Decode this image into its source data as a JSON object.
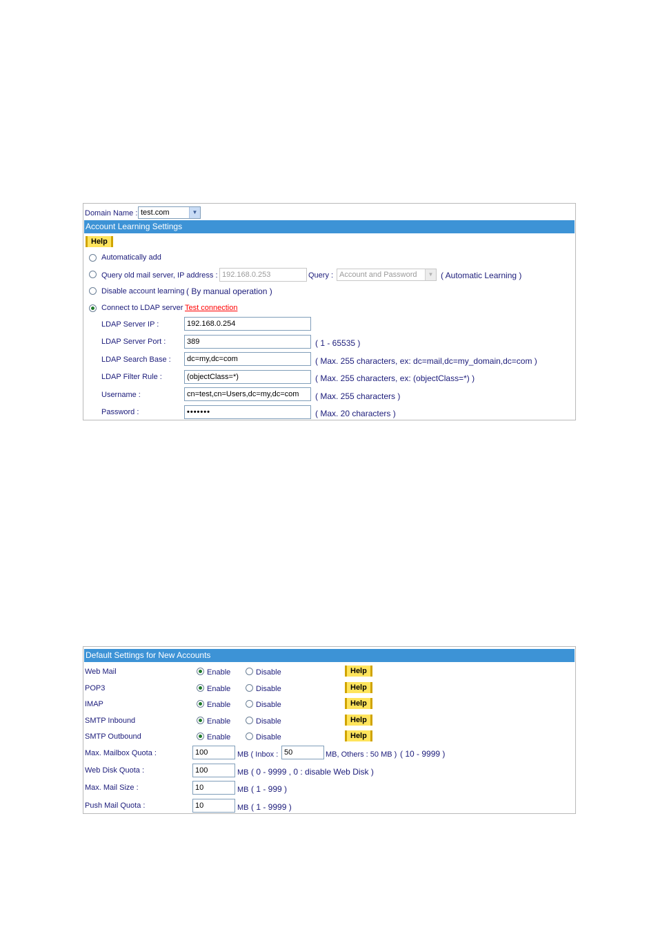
{
  "account_learning": {
    "domain_label": "Domain Name :",
    "domain_value": "test.com",
    "section_title": "Account Learning Settings",
    "help_label": "Help",
    "auto_add_label": "Automatically add",
    "query_old_label": "Query old mail server, IP address :",
    "query_ip_value": "192.168.0.253",
    "query_label": "Query :",
    "query_select_value": "Account and Password",
    "query_note": "( Automatic Learning )",
    "disable_label": "Disable account learning",
    "disable_note": "( By manual operation )",
    "ldap_label": "Connect to LDAP server",
    "test_connection_label": "Test connection",
    "fields": [
      {
        "label": "LDAP Server IP :",
        "value": "192.168.0.254",
        "note": ""
      },
      {
        "label": "LDAP Server Port :",
        "value": "389",
        "note": "( 1 - 65535 )"
      },
      {
        "label": "LDAP Search Base :",
        "value": "dc=my,dc=com",
        "note": "( Max. 255 characters, ex: dc=mail,dc=my_domain,dc=com )"
      },
      {
        "label": "LDAP Filter Rule :",
        "value": "(objectClass=*)",
        "note": "( Max. 255 characters, ex: (objectClass=*) )"
      },
      {
        "label": "Username :",
        "value": "cn=test,cn=Users,dc=my,dc=com",
        "note": "( Max. 255 characters )"
      },
      {
        "label": "Password :",
        "value": "•••••••",
        "note": "( Max. 20 characters )"
      }
    ],
    "selected_option": "ldap"
  },
  "defaults": {
    "section_title": "Default Settings for New Accounts",
    "enable_label": "Enable",
    "disable_label": "Disable",
    "help_label": "Help",
    "services": [
      {
        "label": "Web Mail",
        "state": "enable"
      },
      {
        "label": "POP3",
        "state": "enable"
      },
      {
        "label": "IMAP",
        "state": "enable"
      },
      {
        "label": "SMTP Inbound",
        "state": "enable"
      },
      {
        "label": "SMTP Outbound",
        "state": "enable"
      }
    ],
    "mailbox_quota": {
      "label": "Max. Mailbox Quota :",
      "value": "100",
      "mb_inbox": "MB  ( Inbox :",
      "inbox_value": "50",
      "others": "MB, Others : 50 MB )",
      "range": "( 10 - 9999 )"
    },
    "web_disk_quota": {
      "label": "Web Disk Quota :",
      "value": "100",
      "unit": "MB",
      "note": "( 0 - 9999 , 0 : disable Web Disk )"
    },
    "max_mail_size": {
      "label": "Max. Mail Size :",
      "value": "10",
      "unit": "MB",
      "note": "( 1 - 999 )"
    },
    "push_mail_quota": {
      "label": "Push Mail Quota :",
      "value": "10",
      "unit": "MB",
      "note": "( 1 - 9999 )"
    }
  }
}
